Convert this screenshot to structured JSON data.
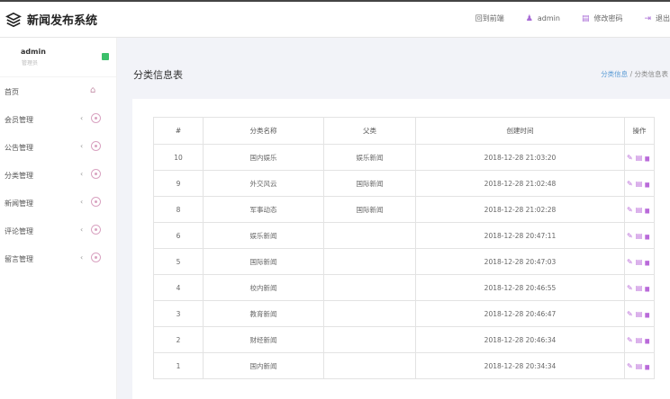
{
  "app": {
    "title": "新闻发布系统"
  },
  "topnav": {
    "frontend": "回到前端",
    "user": "admin",
    "change_pwd": "修改密码",
    "logout": "退出"
  },
  "user": {
    "name": "admin",
    "role": "管理员"
  },
  "sidebar": {
    "items": [
      {
        "label": "首页"
      },
      {
        "label": "会员管理"
      },
      {
        "label": "公告管理"
      },
      {
        "label": "分类管理"
      },
      {
        "label": "新闻管理"
      },
      {
        "label": "评论管理"
      },
      {
        "label": "留言管理"
      }
    ]
  },
  "page": {
    "title": "分类信息表",
    "breadcrumb": {
      "parent": "分类信息",
      "sep": "/",
      "current": "分类信息表"
    }
  },
  "table": {
    "headers": [
      "#",
      "分类名称",
      "父类",
      "创建时间",
      "操作"
    ],
    "rows": [
      {
        "id": "10",
        "name": "国内娱乐",
        "parent": "娱乐新闻",
        "created": "2018-12-28 21:03:20"
      },
      {
        "id": "9",
        "name": "外交风云",
        "parent": "国际新闻",
        "created": "2018-12-28 21:02:48"
      },
      {
        "id": "8",
        "name": "军事动态",
        "parent": "国际新闻",
        "created": "2018-12-28 21:02:28"
      },
      {
        "id": "6",
        "name": "娱乐新闻",
        "parent": "",
        "created": "2018-12-28 20:47:11"
      },
      {
        "id": "5",
        "name": "国际新闻",
        "parent": "",
        "created": "2018-12-28 20:47:03"
      },
      {
        "id": "4",
        "name": "校内新闻",
        "parent": "",
        "created": "2018-12-28 20:46:55"
      },
      {
        "id": "3",
        "name": "教育新闻",
        "parent": "",
        "created": "2018-12-28 20:46:47"
      },
      {
        "id": "2",
        "name": "财经新闻",
        "parent": "",
        "created": "2018-12-28 20:46:34"
      },
      {
        "id": "1",
        "name": "国内新闻",
        "parent": "",
        "created": "2018-12-28 20:34:34"
      }
    ]
  },
  "icons": {
    "row_actions": [
      "pencil-icon",
      "list-icon",
      "trash-icon"
    ]
  }
}
